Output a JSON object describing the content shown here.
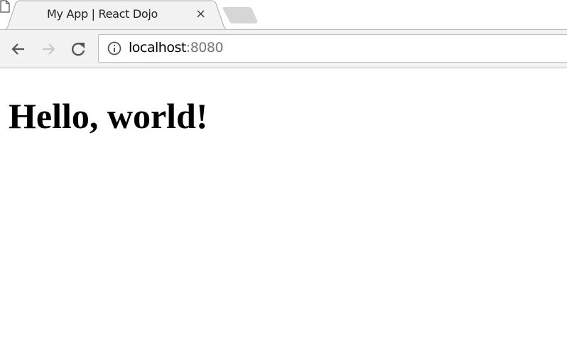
{
  "tab": {
    "title": "My App | React Dojo",
    "close_label": "×",
    "icon": "page-icon"
  },
  "toolbar": {
    "back_icon": "arrow-left-icon",
    "forward_icon": "arrow-right-icon",
    "reload_icon": "reload-icon"
  },
  "address": {
    "host": "localhost",
    "port": ":8080",
    "icon": "info-icon"
  },
  "page": {
    "heading": "Hello, world!"
  }
}
